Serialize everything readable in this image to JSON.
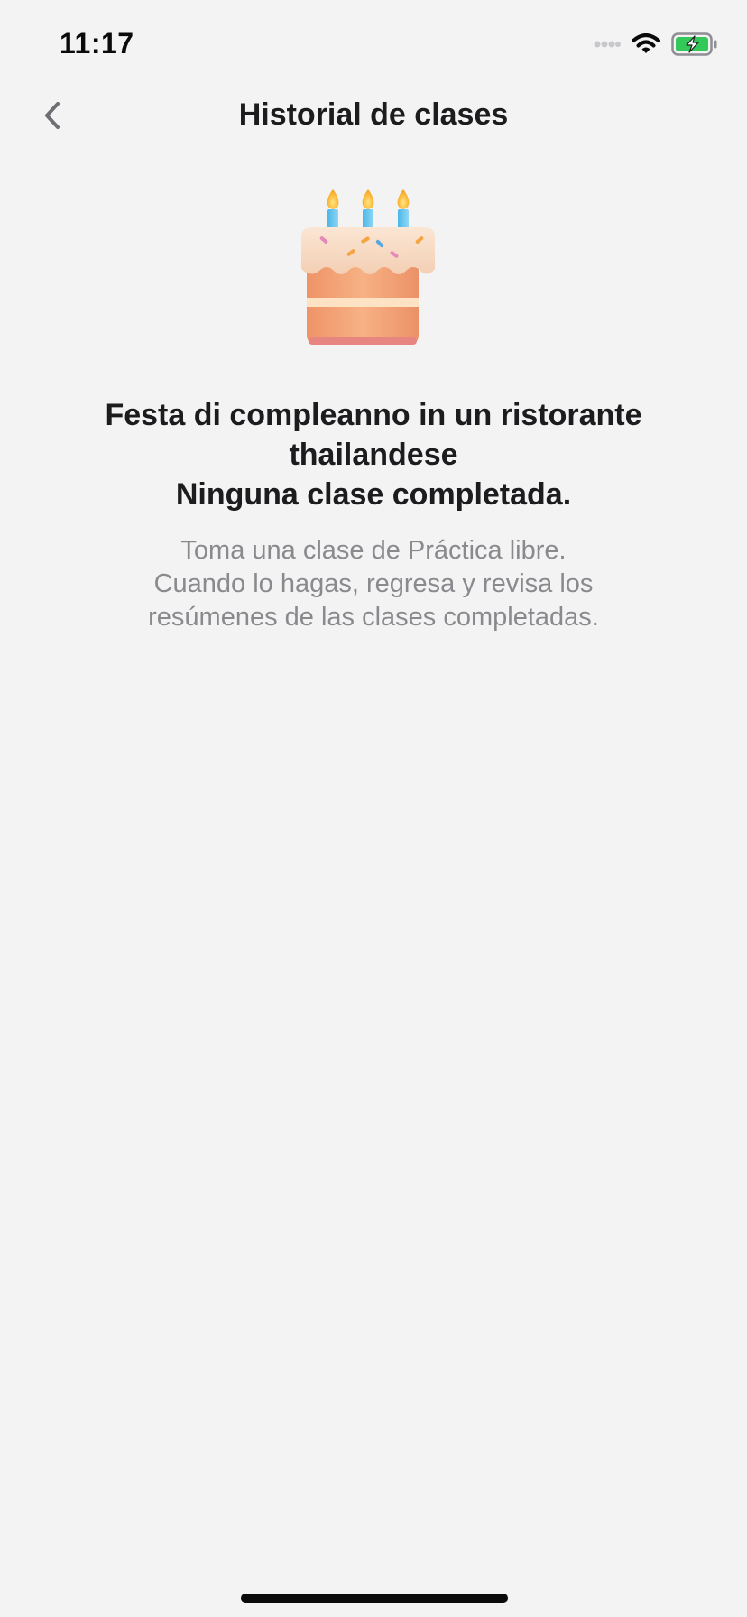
{
  "status_bar": {
    "time": "11:17",
    "icons": [
      "signal-dots-icon",
      "wifi-icon",
      "battery-charging-icon"
    ],
    "battery_color": "#34c759"
  },
  "nav": {
    "title": "Historial de clases",
    "back_icon": "chevron-left-icon"
  },
  "empty_state": {
    "icon": "birthday-cake-icon",
    "title_line_1": "Festa di compleanno in un ristorante",
    "title_line_2": "thailandese",
    "title_line_3": "Ninguna clase completada.",
    "description_line_1": "Toma una clase de Práctica libre.",
    "description_line_2": "Cuando lo hagas, regresa y revisa los",
    "description_line_3": "resúmenes de las clases completadas."
  }
}
